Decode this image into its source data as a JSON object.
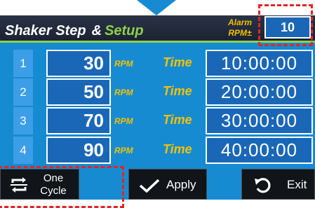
{
  "header": {
    "title_main": "Shaker Step",
    "title_amp": "&",
    "title_setup": "Setup",
    "alarm_label_line1": "Alarm",
    "alarm_label_line2": "RPM±",
    "alarm_value": "10"
  },
  "steps": [
    {
      "index": "1",
      "rpm": "30",
      "rpm_unit": "RPM",
      "time_label": "Time",
      "time": "10:00:00"
    },
    {
      "index": "2",
      "rpm": "50",
      "rpm_unit": "RPM",
      "time_label": "Time",
      "time": "20:00:00"
    },
    {
      "index": "3",
      "rpm": "70",
      "rpm_unit": "RPM",
      "time_label": "Time",
      "time": "30:00:00"
    },
    {
      "index": "4",
      "rpm": "90",
      "rpm_unit": "RPM",
      "time_label": "Time",
      "time": "40:00:00"
    }
  ],
  "buttons": {
    "cycle_line1": "One",
    "cycle_line2": "Cycle",
    "apply": "Apply",
    "exit": "Exit"
  },
  "colors": {
    "background": "#168bd2",
    "header": "#1b2233",
    "accent_green": "#8ed14a",
    "label_yellow": "#f2c200",
    "highlight_red": "#e32424"
  }
}
